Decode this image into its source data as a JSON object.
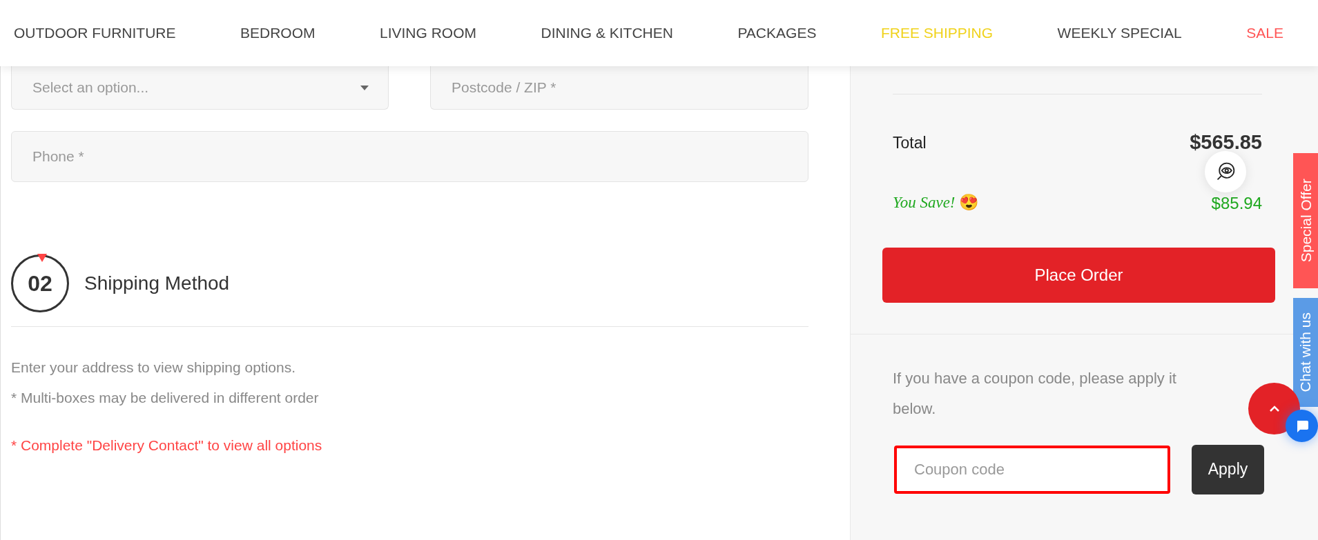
{
  "nav": {
    "items": [
      {
        "label": "OUTDOOR FURNITURE",
        "kind": "normal"
      },
      {
        "label": "BEDROOM",
        "kind": "normal"
      },
      {
        "label": "LIVING ROOM",
        "kind": "normal"
      },
      {
        "label": "DINING & KITCHEN",
        "kind": "normal"
      },
      {
        "label": "PACKAGES",
        "kind": "normal"
      },
      {
        "label": "FREE SHIPPING",
        "kind": "highlight"
      },
      {
        "label": "WEEKLY SPECIAL",
        "kind": "normal"
      },
      {
        "label": "SALE",
        "kind": "sale"
      }
    ]
  },
  "address": {
    "region_select": {
      "placeholder": "Select an option..."
    },
    "postcode": {
      "placeholder": "Postcode / ZIP *"
    },
    "phone": {
      "placeholder": "Phone *"
    }
  },
  "shipping": {
    "step": "02",
    "title": "Shipping Method",
    "notes": [
      "Enter your address to view shipping options.",
      "* Multi-boxes may be delivered in different order"
    ],
    "warning": "* Complete \"Delivery Contact\" to view all options"
  },
  "summary": {
    "total_label": "Total",
    "total_value": "$565.85",
    "save_label": "You Save!",
    "save_emoji": "😍",
    "save_value": "$85.94",
    "place_order": "Place Order"
  },
  "coupon": {
    "text": "If you have a coupon code, please apply it below.",
    "placeholder": "Coupon code",
    "apply": "Apply"
  },
  "side_tabs": [
    "Special Offer",
    "Chat with us"
  ]
}
